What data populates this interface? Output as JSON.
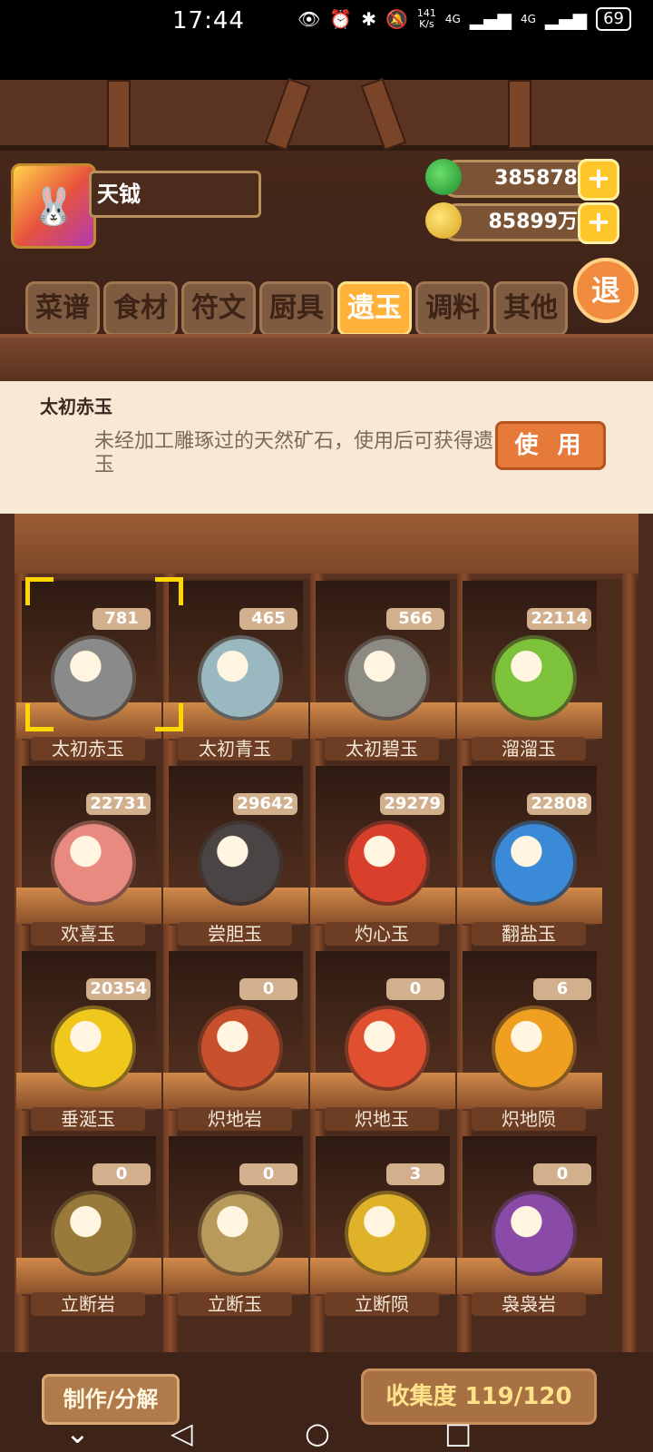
{
  "status": {
    "time": "17:44",
    "speed": "141\nK/s",
    "net1": "4G",
    "net2": "4G",
    "battery": "69"
  },
  "player": {
    "name": "天钺",
    "jade_currency": "385878",
    "coin_currency": "85899万"
  },
  "exit_label": "退",
  "tabs": [
    "菜谱",
    "食材",
    "符文",
    "厨具",
    "遗玉",
    "调料",
    "其他"
  ],
  "active_tab": "遗玉",
  "detail": {
    "title": "太初赤玉",
    "description": "未经加工雕琢过的天然矿石，使用后可获得遗玉",
    "use_label": "使 用"
  },
  "items": [
    {
      "name": "太初赤玉",
      "count": "781",
      "icon": "red-ore-icon",
      "color": "#8a8a8a"
    },
    {
      "name": "太初青玉",
      "count": "465",
      "icon": "blue-ore-icon",
      "color": "#9ab8c0"
    },
    {
      "name": "太初碧玉",
      "count": "566",
      "icon": "green-ore-icon",
      "color": "#8c8c84"
    },
    {
      "name": "溜溜玉",
      "count": "22114",
      "icon": "green-jade-icon",
      "color": "#7cc23a"
    },
    {
      "name": "欢喜玉",
      "count": "22731",
      "icon": "pink-jade-icon",
      "color": "#e88a80"
    },
    {
      "name": "尝胆玉",
      "count": "29642",
      "icon": "black-jade-icon",
      "color": "#4a4444"
    },
    {
      "name": "灼心玉",
      "count": "29279",
      "icon": "red-jade-icon",
      "color": "#d8402c"
    },
    {
      "name": "翻盐玉",
      "count": "22808",
      "icon": "blue-jade-icon",
      "color": "#3a8ad8"
    },
    {
      "name": "垂涎玉",
      "count": "20354",
      "icon": "yellow-jade-icon",
      "color": "#f0c81c"
    },
    {
      "name": "炽地岩",
      "count": "0",
      "icon": "fire-rock-icon",
      "color": "#c8502c"
    },
    {
      "name": "炽地玉",
      "count": "0",
      "icon": "fire-jade-icon",
      "color": "#e05030"
    },
    {
      "name": "炽地陨",
      "count": "6",
      "icon": "fire-meteor-icon",
      "color": "#f0a020"
    },
    {
      "name": "立断岩",
      "count": "0",
      "icon": "cut-rock-icon",
      "color": "#9a7a3a"
    },
    {
      "name": "立断玉",
      "count": "0",
      "icon": "cut-jade-icon",
      "color": "#b89a5a"
    },
    {
      "name": "立断陨",
      "count": "3",
      "icon": "cut-meteor-icon",
      "color": "#e0b22a"
    },
    {
      "name": "袅袅岩",
      "count": "0",
      "icon": "smoke-rock-icon",
      "color": "#8a4aa8"
    }
  ],
  "make_label": "制作/分解",
  "collection_label": "收集度 119/120"
}
